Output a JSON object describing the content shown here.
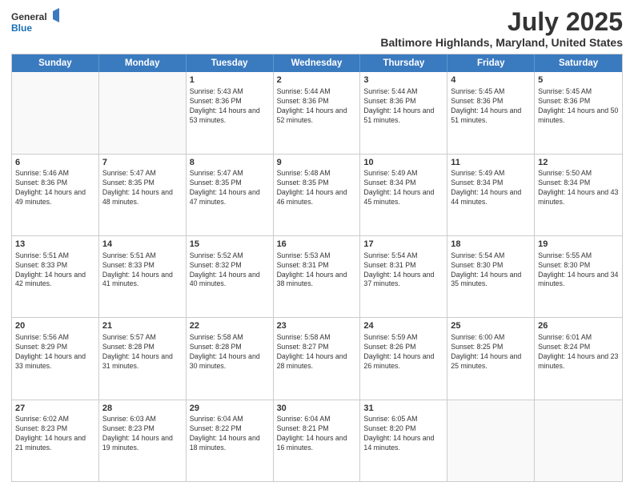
{
  "logo": {
    "general": "General",
    "blue": "Blue"
  },
  "title": "July 2025",
  "subtitle": "Baltimore Highlands, Maryland, United States",
  "header_days": [
    "Sunday",
    "Monday",
    "Tuesday",
    "Wednesday",
    "Thursday",
    "Friday",
    "Saturday"
  ],
  "weeks": [
    [
      {
        "day": "",
        "sunrise": "",
        "sunset": "",
        "daylight": ""
      },
      {
        "day": "",
        "sunrise": "",
        "sunset": "",
        "daylight": ""
      },
      {
        "day": "1",
        "sunrise": "Sunrise: 5:43 AM",
        "sunset": "Sunset: 8:36 PM",
        "daylight": "Daylight: 14 hours and 53 minutes."
      },
      {
        "day": "2",
        "sunrise": "Sunrise: 5:44 AM",
        "sunset": "Sunset: 8:36 PM",
        "daylight": "Daylight: 14 hours and 52 minutes."
      },
      {
        "day": "3",
        "sunrise": "Sunrise: 5:44 AM",
        "sunset": "Sunset: 8:36 PM",
        "daylight": "Daylight: 14 hours and 51 minutes."
      },
      {
        "day": "4",
        "sunrise": "Sunrise: 5:45 AM",
        "sunset": "Sunset: 8:36 PM",
        "daylight": "Daylight: 14 hours and 51 minutes."
      },
      {
        "day": "5",
        "sunrise": "Sunrise: 5:45 AM",
        "sunset": "Sunset: 8:36 PM",
        "daylight": "Daylight: 14 hours and 50 minutes."
      }
    ],
    [
      {
        "day": "6",
        "sunrise": "Sunrise: 5:46 AM",
        "sunset": "Sunset: 8:36 PM",
        "daylight": "Daylight: 14 hours and 49 minutes."
      },
      {
        "day": "7",
        "sunrise": "Sunrise: 5:47 AM",
        "sunset": "Sunset: 8:35 PM",
        "daylight": "Daylight: 14 hours and 48 minutes."
      },
      {
        "day": "8",
        "sunrise": "Sunrise: 5:47 AM",
        "sunset": "Sunset: 8:35 PM",
        "daylight": "Daylight: 14 hours and 47 minutes."
      },
      {
        "day": "9",
        "sunrise": "Sunrise: 5:48 AM",
        "sunset": "Sunset: 8:35 PM",
        "daylight": "Daylight: 14 hours and 46 minutes."
      },
      {
        "day": "10",
        "sunrise": "Sunrise: 5:49 AM",
        "sunset": "Sunset: 8:34 PM",
        "daylight": "Daylight: 14 hours and 45 minutes."
      },
      {
        "day": "11",
        "sunrise": "Sunrise: 5:49 AM",
        "sunset": "Sunset: 8:34 PM",
        "daylight": "Daylight: 14 hours and 44 minutes."
      },
      {
        "day": "12",
        "sunrise": "Sunrise: 5:50 AM",
        "sunset": "Sunset: 8:34 PM",
        "daylight": "Daylight: 14 hours and 43 minutes."
      }
    ],
    [
      {
        "day": "13",
        "sunrise": "Sunrise: 5:51 AM",
        "sunset": "Sunset: 8:33 PM",
        "daylight": "Daylight: 14 hours and 42 minutes."
      },
      {
        "day": "14",
        "sunrise": "Sunrise: 5:51 AM",
        "sunset": "Sunset: 8:33 PM",
        "daylight": "Daylight: 14 hours and 41 minutes."
      },
      {
        "day": "15",
        "sunrise": "Sunrise: 5:52 AM",
        "sunset": "Sunset: 8:32 PM",
        "daylight": "Daylight: 14 hours and 40 minutes."
      },
      {
        "day": "16",
        "sunrise": "Sunrise: 5:53 AM",
        "sunset": "Sunset: 8:31 PM",
        "daylight": "Daylight: 14 hours and 38 minutes."
      },
      {
        "day": "17",
        "sunrise": "Sunrise: 5:54 AM",
        "sunset": "Sunset: 8:31 PM",
        "daylight": "Daylight: 14 hours and 37 minutes."
      },
      {
        "day": "18",
        "sunrise": "Sunrise: 5:54 AM",
        "sunset": "Sunset: 8:30 PM",
        "daylight": "Daylight: 14 hours and 35 minutes."
      },
      {
        "day": "19",
        "sunrise": "Sunrise: 5:55 AM",
        "sunset": "Sunset: 8:30 PM",
        "daylight": "Daylight: 14 hours and 34 minutes."
      }
    ],
    [
      {
        "day": "20",
        "sunrise": "Sunrise: 5:56 AM",
        "sunset": "Sunset: 8:29 PM",
        "daylight": "Daylight: 14 hours and 33 minutes."
      },
      {
        "day": "21",
        "sunrise": "Sunrise: 5:57 AM",
        "sunset": "Sunset: 8:28 PM",
        "daylight": "Daylight: 14 hours and 31 minutes."
      },
      {
        "day": "22",
        "sunrise": "Sunrise: 5:58 AM",
        "sunset": "Sunset: 8:28 PM",
        "daylight": "Daylight: 14 hours and 30 minutes."
      },
      {
        "day": "23",
        "sunrise": "Sunrise: 5:58 AM",
        "sunset": "Sunset: 8:27 PM",
        "daylight": "Daylight: 14 hours and 28 minutes."
      },
      {
        "day": "24",
        "sunrise": "Sunrise: 5:59 AM",
        "sunset": "Sunset: 8:26 PM",
        "daylight": "Daylight: 14 hours and 26 minutes."
      },
      {
        "day": "25",
        "sunrise": "Sunrise: 6:00 AM",
        "sunset": "Sunset: 8:25 PM",
        "daylight": "Daylight: 14 hours and 25 minutes."
      },
      {
        "day": "26",
        "sunrise": "Sunrise: 6:01 AM",
        "sunset": "Sunset: 8:24 PM",
        "daylight": "Daylight: 14 hours and 23 minutes."
      }
    ],
    [
      {
        "day": "27",
        "sunrise": "Sunrise: 6:02 AM",
        "sunset": "Sunset: 8:23 PM",
        "daylight": "Daylight: 14 hours and 21 minutes."
      },
      {
        "day": "28",
        "sunrise": "Sunrise: 6:03 AM",
        "sunset": "Sunset: 8:23 PM",
        "daylight": "Daylight: 14 hours and 19 minutes."
      },
      {
        "day": "29",
        "sunrise": "Sunrise: 6:04 AM",
        "sunset": "Sunset: 8:22 PM",
        "daylight": "Daylight: 14 hours and 18 minutes."
      },
      {
        "day": "30",
        "sunrise": "Sunrise: 6:04 AM",
        "sunset": "Sunset: 8:21 PM",
        "daylight": "Daylight: 14 hours and 16 minutes."
      },
      {
        "day": "31",
        "sunrise": "Sunrise: 6:05 AM",
        "sunset": "Sunset: 8:20 PM",
        "daylight": "Daylight: 14 hours and 14 minutes."
      },
      {
        "day": "",
        "sunrise": "",
        "sunset": "",
        "daylight": ""
      },
      {
        "day": "",
        "sunrise": "",
        "sunset": "",
        "daylight": ""
      }
    ]
  ]
}
